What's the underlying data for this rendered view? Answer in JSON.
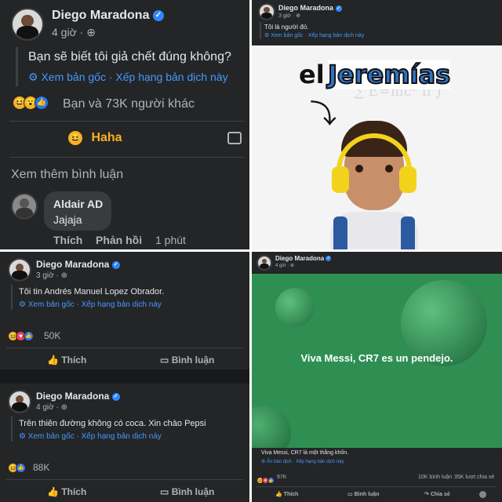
{
  "posts": {
    "p1": {
      "author": "Diego Maradona",
      "time": "4 giờ",
      "text": "Bạn sẽ biết tôi giả chết đúng không?",
      "see_original": "Xem bản gốc",
      "rate_translation": "· Xếp hạng bản dịch này",
      "reactions_text": "Bạn và 73K người khác",
      "haha_label": "Haha",
      "more_comments": "Xem thêm bình luận",
      "comment": {
        "author": "Aldair AD",
        "text": "Jajaja",
        "like": "Thích",
        "reply": "Phản hồi",
        "time": "1 phút"
      }
    },
    "p2": {
      "author": "Diego Maradona",
      "time": "3 giờ",
      "text": "Tôi là người đó.",
      "see_original": "Xem bản gốc",
      "rate_translation": "· Xếp hạng bản dịch này",
      "meme_el": "el",
      "meme_name": "Jeremías"
    },
    "p3": {
      "author": "Diego Maradona",
      "time": "3 giờ",
      "text": "Tôi tin Andrés Manuel Lopez Obrador.",
      "see_original": "Xem bản gốc",
      "rate_translation": "· Xếp hạng bản dịch này",
      "reactions_count": "50K",
      "like": "Thích",
      "comment": "Bình luận"
    },
    "p5": {
      "author": "Diego Maradona",
      "time": "4 giờ",
      "text": "Trên thiên đường không có coca. Xin chào Pepsi",
      "see_original": "Xem bản gốc",
      "rate_translation": "· Xếp hạng bản dịch này",
      "reactions_count": "88K",
      "like": "Thích",
      "comment": "Bình luận"
    },
    "p4": {
      "author": "Diego Maradona",
      "time": "4 giờ",
      "image_text": "Viva Messi, CR7 es un pendejo.",
      "caption": "Viva Messi, CR7 là một thằng khốn.",
      "see_original": "Ẩn bản dịch",
      "rate_translation": "· Xếp hạng bản dịch này",
      "reactions_count": "97K",
      "comments_count": "10K bình luận",
      "shares_count": "35K lượt chia sẻ",
      "like": "Thích",
      "comment": "Bình luận",
      "share": "Chia sẻ"
    }
  },
  "colors": {
    "bg": "#242526",
    "accent": "#2d88ff",
    "green": "#2e8b4e",
    "haha": "#f7b125"
  },
  "icons": [
    "globe-icon",
    "verified-icon",
    "gear-icon",
    "haha-icon",
    "like-icon",
    "comment-icon",
    "share-icon"
  ]
}
